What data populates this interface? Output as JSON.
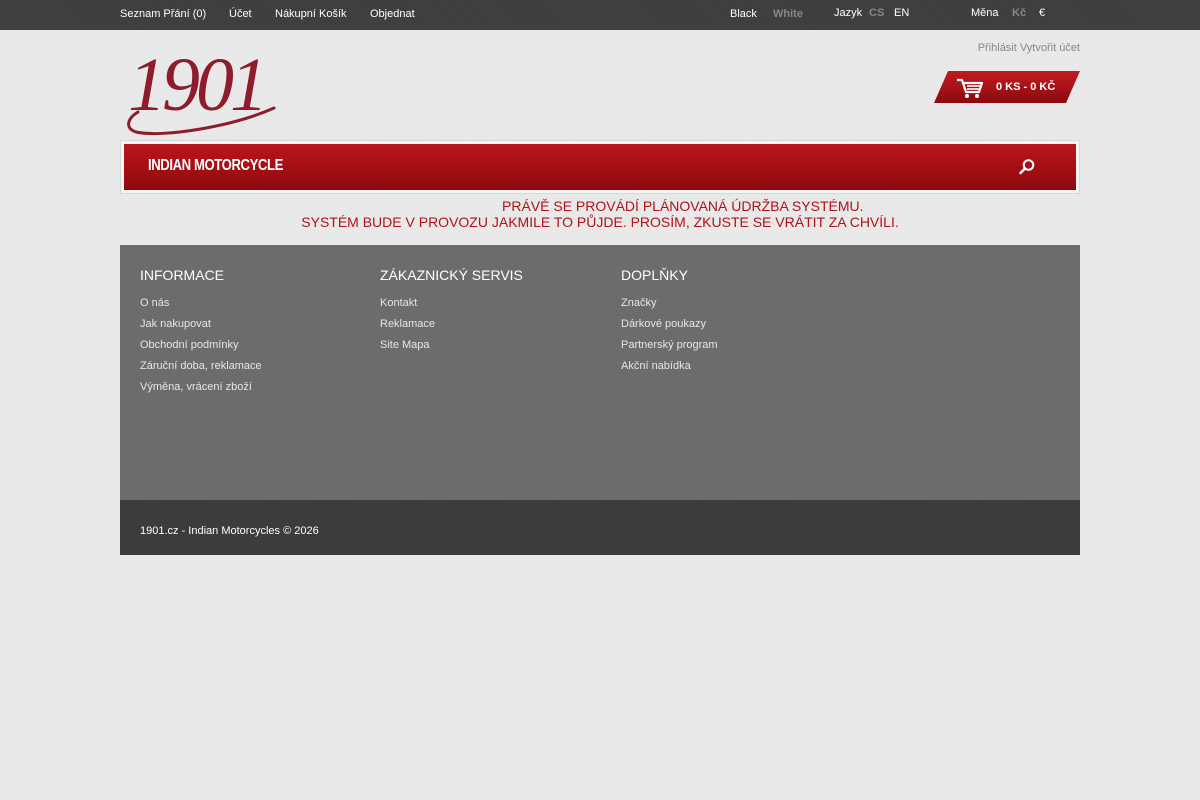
{
  "topbar": {
    "wishlist": "Seznam Přání (0)",
    "account": "Účet",
    "cart": "Nákupní Košík",
    "checkout": "Objednat",
    "theme_black": "Black",
    "theme_white": "White",
    "language_label": "Jazyk",
    "lang_cs": "CS",
    "lang_en": "EN",
    "currency_label": "Měna",
    "currency_czk": "Kč",
    "currency_eur": "€"
  },
  "header": {
    "logo_text": "1901",
    "login": "Přihlásit",
    "register": "Vytvořit účet",
    "cart_summary": "0 KS - 0 KČ"
  },
  "nav": {
    "brand": "INDIAN MOTORCYCLE"
  },
  "notice": {
    "line1": "PRÁVĚ SE PROVÁDÍ PLÁNOVANÁ ÚDRŽBA SYSTÉMU.",
    "line2": "SYSTÉM BUDE V PROVOZU JAKMILE TO PŮJDE. PROSÍM, ZKUSTE SE VRÁTIT ZA CHVÍLI."
  },
  "footer": {
    "info": {
      "title": "INFORMACE",
      "items": [
        "O nás",
        "Jak nakupovat",
        "Obchodní podmínky",
        "Záruční doba, reklamace",
        "Výměna, vrácení zboží"
      ]
    },
    "service": {
      "title": "ZÁKAZNICKÝ SERVIS",
      "items": [
        "Kontakt",
        "Reklamace",
        "Site Mapa"
      ]
    },
    "extras": {
      "title": "DOPLŇKY",
      "items": [
        "Značky",
        "Dárkové poukazy",
        "Partnerský program",
        "Akční nabídka"
      ]
    },
    "copyright": "1901.cz - Indian Motorcycles © 2026"
  },
  "colors": {
    "brand_red": "#a50f14",
    "topbar": "#3d3d3d",
    "footer": "#6a6a6a",
    "footer_bottom": "#3a3a3a"
  }
}
